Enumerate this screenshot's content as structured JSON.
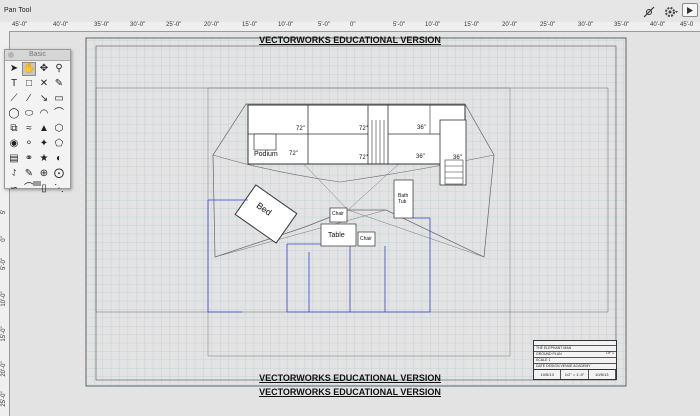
{
  "toolbar": {
    "active_tool": "Pan Tool",
    "snap_icon": "snap-settings-icon",
    "gear_icon": "gear-icon",
    "expand_icon": "triangle-right-icon"
  },
  "rulers": {
    "top": [
      "45'-0\"",
      "40'-0\"",
      "35'-0\"",
      "30'-0\"",
      "25'-0\"",
      "20'-0\"",
      "15'-0\"",
      "10'-0\"",
      "5'-0\"",
      "0\"",
      "5'-0\"",
      "10'-0\"",
      "15'-0\"",
      "20'-0\"",
      "25'-0\"",
      "30'-0\"",
      "35'-0\"",
      "40'-0\"",
      "45'-0"
    ],
    "left": [
      "5'",
      "0\"",
      "5'-0\"",
      "10'-0\"",
      "15'-0\"",
      "20'-0\"",
      "25'-0\""
    ]
  },
  "palette": {
    "title": "Basic",
    "tools": [
      "select-arrow-icon",
      "pan-hand-icon",
      "flyover-icon",
      "zoom-icon",
      "text-icon",
      "rectangle-callout-icon",
      "x-mark-icon",
      "eyedropper-icon",
      "line-icon",
      "double-line-icon",
      "dim-arrow-icon",
      "rounded-rect-icon",
      "circle-icon",
      "oval-icon",
      "arc-icon",
      "line-arc-icon",
      "polyline-icon",
      "freehand-icon",
      "shapes-icon",
      "hexagon-icon",
      "pipette-icon",
      "push-pull-icon",
      "mirror-icon",
      "flip-icon",
      "clip-icon",
      "offset-icon",
      "wand-icon",
      "bucket-icon",
      "fillet-icon",
      "brush-icon",
      "loci-icon",
      "ellipse-icon",
      "stair-icon",
      "attach-icon",
      "eraser-icon",
      "more-icon"
    ]
  },
  "drawing": {
    "watermark_top": "VECTORWORKS EDUCATIONAL VERSION",
    "watermark_bottom1": "VECTORWORKS EDUCATIONAL VERSION",
    "watermark_bottom2": "VECTORWORKS EDUCATIONAL VERSION",
    "labels": {
      "podium": "Podium",
      "bed": "Bed",
      "chair1": "Chair",
      "chair2": "Chair",
      "table": "Table",
      "bath": "Bath",
      "tub": "Tub",
      "d1": "72\"",
      "d2": "72\"",
      "d3": "72\"",
      "d4": "72\"",
      "d5": "36\"",
      "d6": "36\"",
      "d7": "36\""
    },
    "title_block": {
      "company": "THE ELEPHANT MAN",
      "row2": "GROUND PLAN",
      "row3": "SCALE 1",
      "row4": "DATE  DESIGN  VENUE  ACADEMY",
      "date1": "10/5/13",
      "scale": "1/2\" = 1'-0\"",
      "date2": "10/5/13",
      "plate": "OF 1"
    }
  }
}
